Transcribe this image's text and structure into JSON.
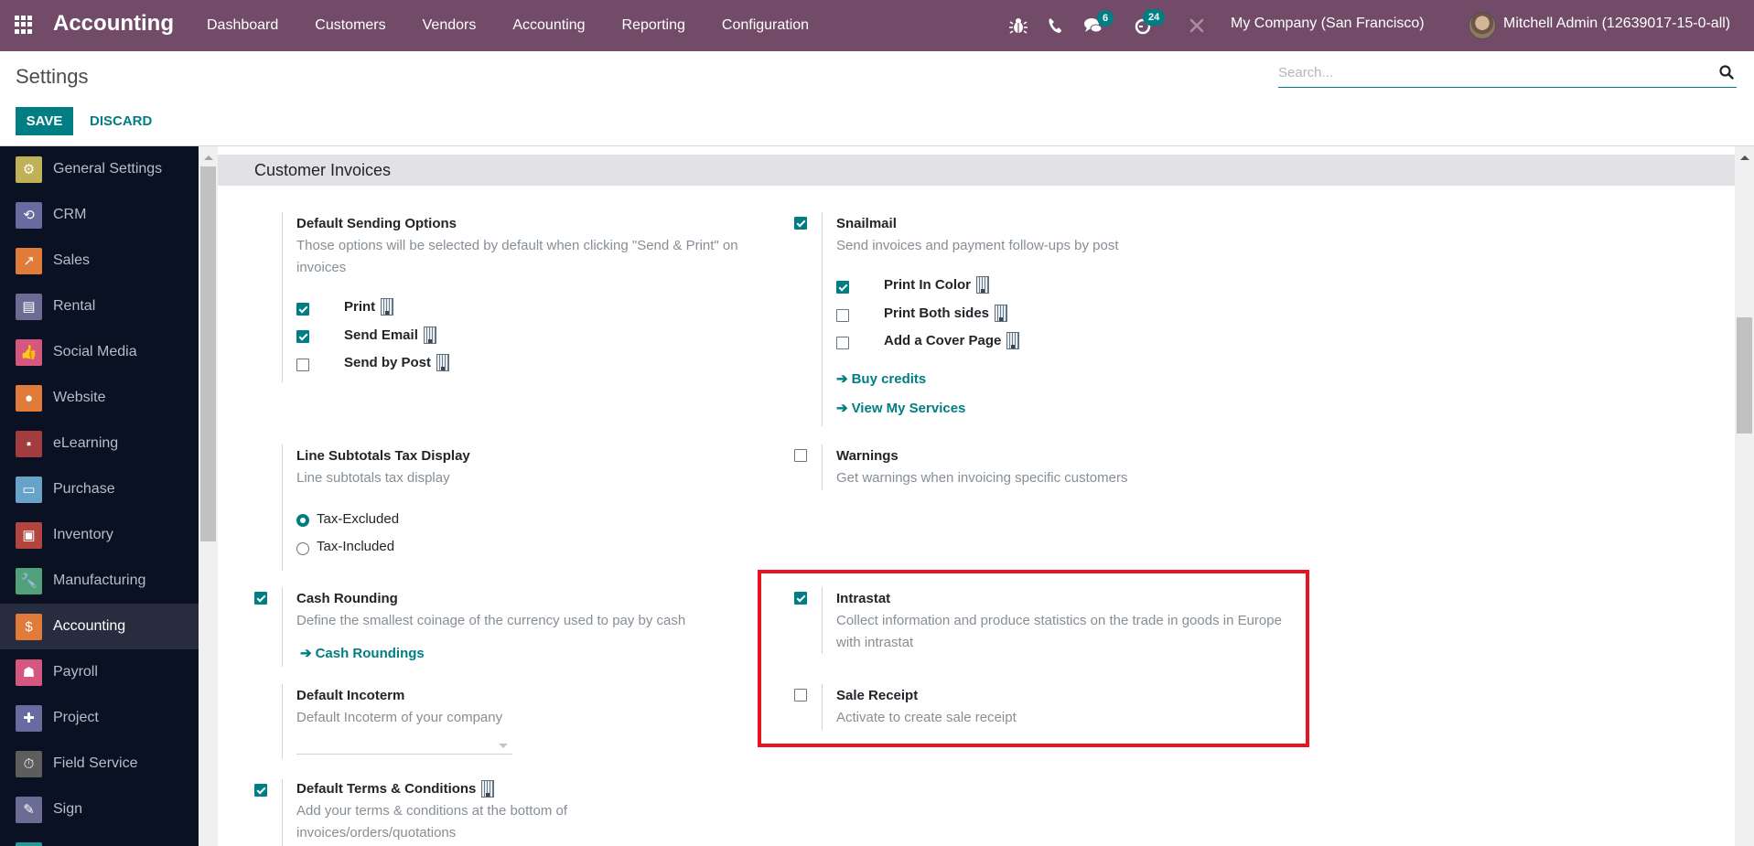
{
  "navbar": {
    "app_name": "Accounting",
    "menu": [
      "Dashboard",
      "Customers",
      "Vendors",
      "Accounting",
      "Reporting",
      "Configuration"
    ],
    "icons": [
      "debug-icon",
      "phone-icon",
      "messages-icon",
      "activity-icon",
      "tools-icon"
    ],
    "messages_count": "6",
    "activities_count": "24",
    "company": "My Company (San Francisco)",
    "user": "Mitchell Admin (12639017-15-0-all)",
    "brand_color": "#714b67"
  },
  "control_panel": {
    "title": "Settings",
    "save_label": "SAVE",
    "discard_label": "DISCARD",
    "search_placeholder": "Search...",
    "accent_color": "#017e84"
  },
  "sidebar": {
    "items": [
      {
        "label": "General Settings",
        "icon": "gear-icon",
        "color": "#c0b157",
        "active": false
      },
      {
        "label": "CRM",
        "icon": "handshake-icon",
        "color": "#686aa0",
        "active": false
      },
      {
        "label": "Sales",
        "icon": "chart-icon",
        "color": "#e07b39",
        "active": false
      },
      {
        "label": "Rental",
        "icon": "rental-icon",
        "color": "#6a6c93",
        "active": false
      },
      {
        "label": "Social Media",
        "icon": "thumbs-up-icon",
        "color": "#d5577f",
        "active": false
      },
      {
        "label": "Website",
        "icon": "globe-icon",
        "color": "#e07b39",
        "active": false
      },
      {
        "label": "eLearning",
        "icon": "presentation-icon",
        "color": "#a33c3f",
        "active": false
      },
      {
        "label": "Purchase",
        "icon": "credit-card-icon",
        "color": "#67a2c8",
        "active": false
      },
      {
        "label": "Inventory",
        "icon": "box-icon",
        "color": "#b3443f",
        "active": false
      },
      {
        "label": "Manufacturing",
        "icon": "wrench-icon",
        "color": "#53a17a",
        "active": false
      },
      {
        "label": "Accounting",
        "icon": "invoice-icon",
        "color": "#e07b39",
        "active": true
      },
      {
        "label": "Payroll",
        "icon": "payroll-icon",
        "color": "#d5577f",
        "active": false
      },
      {
        "label": "Project",
        "icon": "puzzle-icon",
        "color": "#686aa0",
        "active": false
      },
      {
        "label": "Field Service",
        "icon": "field-service-icon",
        "color": "#5d5d5d",
        "active": false
      },
      {
        "label": "Sign",
        "icon": "sign-icon",
        "color": "#6a6c93",
        "active": false
      },
      {
        "label": "",
        "icon": "app-icon",
        "color": "#1f9a9a",
        "active": false
      }
    ]
  },
  "section": {
    "title": "Customer Invoices",
    "settings": {
      "default_sending_options": {
        "title": "Default Sending Options",
        "description": "Those options will be selected by default when clicking \"Send & Print\" on invoices",
        "options": [
          {
            "label": "Print",
            "checked": true
          },
          {
            "label": "Send Email",
            "checked": true
          },
          {
            "label": "Send by Post",
            "checked": false
          }
        ]
      },
      "snailmail": {
        "title": "Snailmail",
        "checked": true,
        "description": "Send invoices and payment follow-ups by post",
        "options": [
          {
            "label": "Print In Color",
            "checked": true
          },
          {
            "label": "Print Both sides",
            "checked": false
          },
          {
            "label": "Add a Cover Page",
            "checked": false
          }
        ],
        "links": [
          "Buy credits",
          "View My Services"
        ]
      },
      "line_subtotals": {
        "title": "Line Subtotals Tax Display",
        "description": "Line subtotals tax display",
        "options": [
          {
            "label": "Tax-Excluded",
            "selected": true
          },
          {
            "label": "Tax-Included",
            "selected": false
          }
        ]
      },
      "warnings": {
        "title": "Warnings",
        "checked": false,
        "description": "Get warnings when invoicing specific customers"
      },
      "cash_rounding": {
        "title": "Cash Rounding",
        "checked": true,
        "description": "Define the smallest coinage of the currency used to pay by cash",
        "link": "Cash Roundings"
      },
      "intrastat": {
        "title": "Intrastat",
        "checked": true,
        "description": "Collect information and produce statistics on the trade in goods in Europe with intrastat"
      },
      "default_incoterm": {
        "title": "Default Incoterm",
        "description": "Default Incoterm of your company",
        "value": ""
      },
      "sale_receipt": {
        "title": "Sale Receipt",
        "checked": false,
        "description": "Activate to create sale receipt"
      },
      "default_terms": {
        "title": "Default Terms & Conditions",
        "checked": true,
        "description": "Add your terms & conditions at the bottom of invoices/orders/quotations"
      }
    }
  },
  "annotation": {
    "highlight_color": "#e5141f"
  }
}
